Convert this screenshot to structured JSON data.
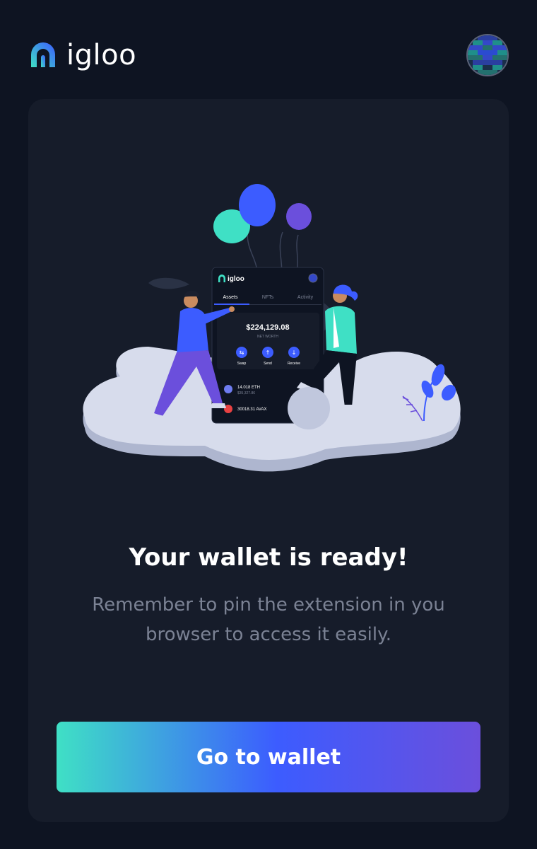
{
  "brand": {
    "name": "igloo"
  },
  "illustration": {
    "phone": {
      "brand": "igloo",
      "tabs": [
        "Assets",
        "NFTs",
        "Activity"
      ],
      "active_tab": "Assets",
      "net_worth_value": "$224,129.08",
      "net_worth_label": "NET WORTH",
      "actions": [
        "Swap",
        "Send",
        "Receive"
      ],
      "assets": [
        {
          "amount": "14.018 ETH",
          "usd": "$35,327.86"
        },
        {
          "amount": "30018.31 AVAX",
          "usd": ""
        }
      ]
    }
  },
  "main": {
    "title": "Your wallet is ready!",
    "subtitle": "Remember to pin the extension in you browser to access it easily."
  },
  "cta": {
    "label": "Go to wallet"
  },
  "colors": {
    "background": "#0e1422",
    "card": "#161c2a",
    "accent_teal": "#3fe0c5",
    "accent_blue": "#3c5cff",
    "accent_purple": "#6b4fdc"
  }
}
